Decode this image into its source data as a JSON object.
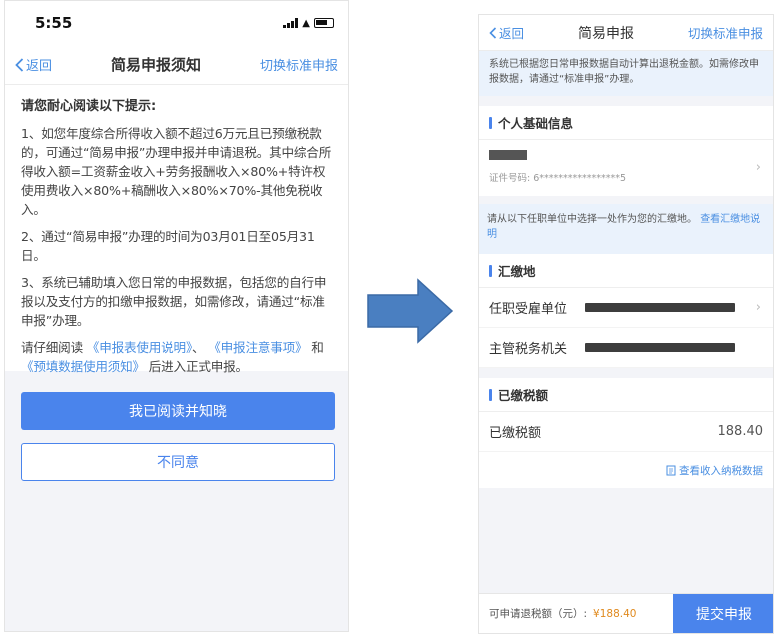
{
  "left_phone": {
    "status_bar": {
      "time": "5:55"
    },
    "nav": {
      "back_label": "返回",
      "title": "简易申报须知",
      "switch_label": "切换标准申报"
    },
    "notice": {
      "heading": "请您耐心阅读以下提示:",
      "item1": "1、如您年度综合所得收入额不超过6万元且已预缴税款的，可通过“简易申报”办理申报并申请退税。其中综合所得收入额=工资薪金收入+劳务报酬收入×80%+特许权使用费收入×80%+稿酬收入×80%×70%-其他免税收入。",
      "item2": "2、通过“简易申报”办理的时间为03月01日至05月31日。",
      "item3": "3、系统已辅助填入您日常的申报数据，包括您的自行申报以及支付方的扣缴申报数据，如需修改，请通过“标准申报”办理。",
      "read_prefix": "请仔细阅读",
      "link1": "《申报表使用说明》",
      "sep": "、",
      "link2": "《申报注意事项》",
      "and": "和",
      "link3": "《预填数据使用须知》",
      "read_suffix": "后进入正式申报。"
    },
    "buttons": {
      "agree": "我已阅读并知晓",
      "disagree": "不同意"
    }
  },
  "right_phone": {
    "nav": {
      "back_label": "返回",
      "title": "简易申报",
      "switch_label": "切换标准申报"
    },
    "info_text": "系统已根据您日常申报数据自动计算出退税金额。如需修改申报数据，请通过“标准申报”办理。",
    "personal_section": {
      "title": "个人基础信息",
      "cert_label": "证件号码: 6*****************5"
    },
    "hint": {
      "text": "请从以下任职单位中选择一处作为您的汇缴地。",
      "link": "查看汇缴地说明"
    },
    "remit_section": {
      "title": "汇缴地",
      "employer_label": "任职受雇单位",
      "tax_office_label": "主管税务机关"
    },
    "paid_section": {
      "title": "已缴税额",
      "paid_label": "已缴税额",
      "paid_amount": "188.40",
      "view_link": "查看收入纳税数据"
    },
    "footer": {
      "refund_label": "可申请退税额（元）:",
      "refund_amount": "¥188.40",
      "submit": "提交申报"
    }
  },
  "colors": {
    "primary": "#4a84ec",
    "link": "#4a8fe2",
    "amount": "#e08a1e",
    "arrow": "#4a7fc1"
  },
  "icons": [
    "back-chevron-icon",
    "signal-icon",
    "wifi-icon",
    "battery-icon",
    "chevron-right-icon",
    "document-icon",
    "arrow-right-icon"
  ]
}
